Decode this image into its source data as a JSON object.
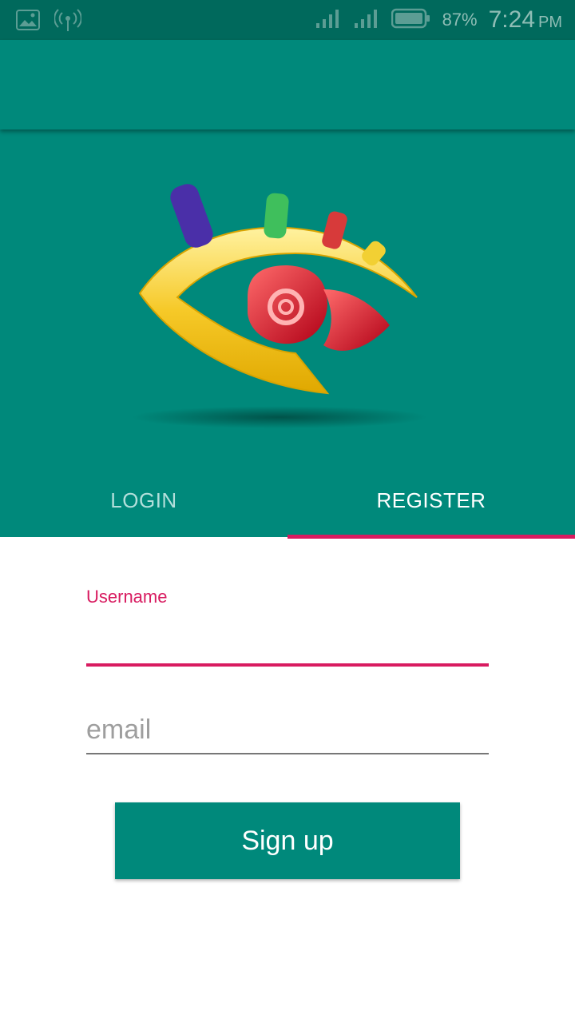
{
  "status_bar": {
    "battery_percent": "87%",
    "time": "7:24",
    "ampm": "PM",
    "icons": [
      "gallery-icon",
      "hotspot-icon",
      "signal-icon",
      "signal-icon",
      "battery-icon"
    ]
  },
  "tabs": [
    {
      "label": "LOGIN",
      "active": false
    },
    {
      "label": "REGISTER",
      "active": true
    }
  ],
  "form": {
    "username_label": "Username",
    "username_value": "",
    "email_placeholder": "email",
    "email_value": "",
    "signup_label": "Sign up"
  },
  "colors": {
    "primary": "#00897b",
    "primary_dark": "#00695c",
    "accent": "#d81b60"
  }
}
